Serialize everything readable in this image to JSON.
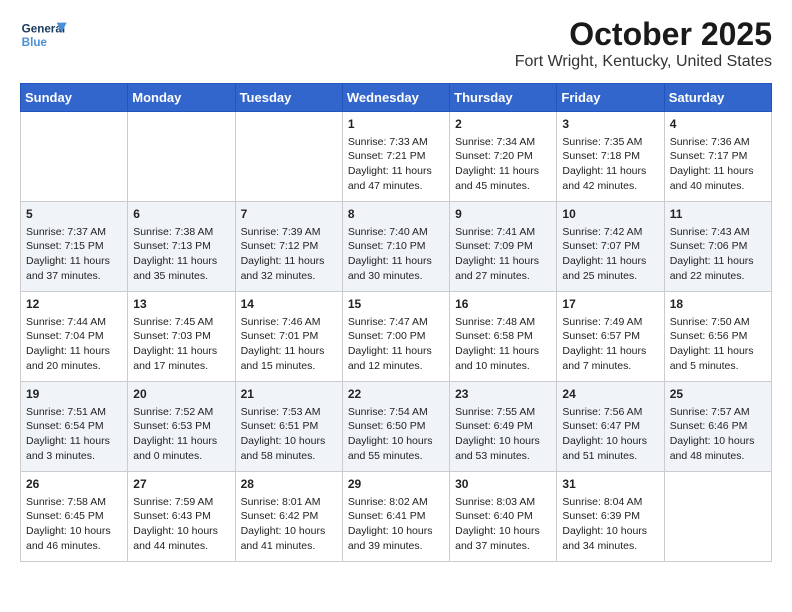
{
  "header": {
    "logo_line1": "General",
    "logo_line2": "Blue",
    "month": "October 2025",
    "location": "Fort Wright, Kentucky, United States"
  },
  "weekdays": [
    "Sunday",
    "Monday",
    "Tuesday",
    "Wednesday",
    "Thursday",
    "Friday",
    "Saturday"
  ],
  "weeks": [
    [
      {
        "day": "",
        "info": ""
      },
      {
        "day": "",
        "info": ""
      },
      {
        "day": "",
        "info": ""
      },
      {
        "day": "1",
        "info": "Sunrise: 7:33 AM\nSunset: 7:21 PM\nDaylight: 11 hours\nand 47 minutes."
      },
      {
        "day": "2",
        "info": "Sunrise: 7:34 AM\nSunset: 7:20 PM\nDaylight: 11 hours\nand 45 minutes."
      },
      {
        "day": "3",
        "info": "Sunrise: 7:35 AM\nSunset: 7:18 PM\nDaylight: 11 hours\nand 42 minutes."
      },
      {
        "day": "4",
        "info": "Sunrise: 7:36 AM\nSunset: 7:17 PM\nDaylight: 11 hours\nand 40 minutes."
      }
    ],
    [
      {
        "day": "5",
        "info": "Sunrise: 7:37 AM\nSunset: 7:15 PM\nDaylight: 11 hours\nand 37 minutes."
      },
      {
        "day": "6",
        "info": "Sunrise: 7:38 AM\nSunset: 7:13 PM\nDaylight: 11 hours\nand 35 minutes."
      },
      {
        "day": "7",
        "info": "Sunrise: 7:39 AM\nSunset: 7:12 PM\nDaylight: 11 hours\nand 32 minutes."
      },
      {
        "day": "8",
        "info": "Sunrise: 7:40 AM\nSunset: 7:10 PM\nDaylight: 11 hours\nand 30 minutes."
      },
      {
        "day": "9",
        "info": "Sunrise: 7:41 AM\nSunset: 7:09 PM\nDaylight: 11 hours\nand 27 minutes."
      },
      {
        "day": "10",
        "info": "Sunrise: 7:42 AM\nSunset: 7:07 PM\nDaylight: 11 hours\nand 25 minutes."
      },
      {
        "day": "11",
        "info": "Sunrise: 7:43 AM\nSunset: 7:06 PM\nDaylight: 11 hours\nand 22 minutes."
      }
    ],
    [
      {
        "day": "12",
        "info": "Sunrise: 7:44 AM\nSunset: 7:04 PM\nDaylight: 11 hours\nand 20 minutes."
      },
      {
        "day": "13",
        "info": "Sunrise: 7:45 AM\nSunset: 7:03 PM\nDaylight: 11 hours\nand 17 minutes."
      },
      {
        "day": "14",
        "info": "Sunrise: 7:46 AM\nSunset: 7:01 PM\nDaylight: 11 hours\nand 15 minutes."
      },
      {
        "day": "15",
        "info": "Sunrise: 7:47 AM\nSunset: 7:00 PM\nDaylight: 11 hours\nand 12 minutes."
      },
      {
        "day": "16",
        "info": "Sunrise: 7:48 AM\nSunset: 6:58 PM\nDaylight: 11 hours\nand 10 minutes."
      },
      {
        "day": "17",
        "info": "Sunrise: 7:49 AM\nSunset: 6:57 PM\nDaylight: 11 hours\nand 7 minutes."
      },
      {
        "day": "18",
        "info": "Sunrise: 7:50 AM\nSunset: 6:56 PM\nDaylight: 11 hours\nand 5 minutes."
      }
    ],
    [
      {
        "day": "19",
        "info": "Sunrise: 7:51 AM\nSunset: 6:54 PM\nDaylight: 11 hours\nand 3 minutes."
      },
      {
        "day": "20",
        "info": "Sunrise: 7:52 AM\nSunset: 6:53 PM\nDaylight: 11 hours\nand 0 minutes."
      },
      {
        "day": "21",
        "info": "Sunrise: 7:53 AM\nSunset: 6:51 PM\nDaylight: 10 hours\nand 58 minutes."
      },
      {
        "day": "22",
        "info": "Sunrise: 7:54 AM\nSunset: 6:50 PM\nDaylight: 10 hours\nand 55 minutes."
      },
      {
        "day": "23",
        "info": "Sunrise: 7:55 AM\nSunset: 6:49 PM\nDaylight: 10 hours\nand 53 minutes."
      },
      {
        "day": "24",
        "info": "Sunrise: 7:56 AM\nSunset: 6:47 PM\nDaylight: 10 hours\nand 51 minutes."
      },
      {
        "day": "25",
        "info": "Sunrise: 7:57 AM\nSunset: 6:46 PM\nDaylight: 10 hours\nand 48 minutes."
      }
    ],
    [
      {
        "day": "26",
        "info": "Sunrise: 7:58 AM\nSunset: 6:45 PM\nDaylight: 10 hours\nand 46 minutes."
      },
      {
        "day": "27",
        "info": "Sunrise: 7:59 AM\nSunset: 6:43 PM\nDaylight: 10 hours\nand 44 minutes."
      },
      {
        "day": "28",
        "info": "Sunrise: 8:01 AM\nSunset: 6:42 PM\nDaylight: 10 hours\nand 41 minutes."
      },
      {
        "day": "29",
        "info": "Sunrise: 8:02 AM\nSunset: 6:41 PM\nDaylight: 10 hours\nand 39 minutes."
      },
      {
        "day": "30",
        "info": "Sunrise: 8:03 AM\nSunset: 6:40 PM\nDaylight: 10 hours\nand 37 minutes."
      },
      {
        "day": "31",
        "info": "Sunrise: 8:04 AM\nSunset: 6:39 PM\nDaylight: 10 hours\nand 34 minutes."
      },
      {
        "day": "",
        "info": ""
      }
    ]
  ]
}
